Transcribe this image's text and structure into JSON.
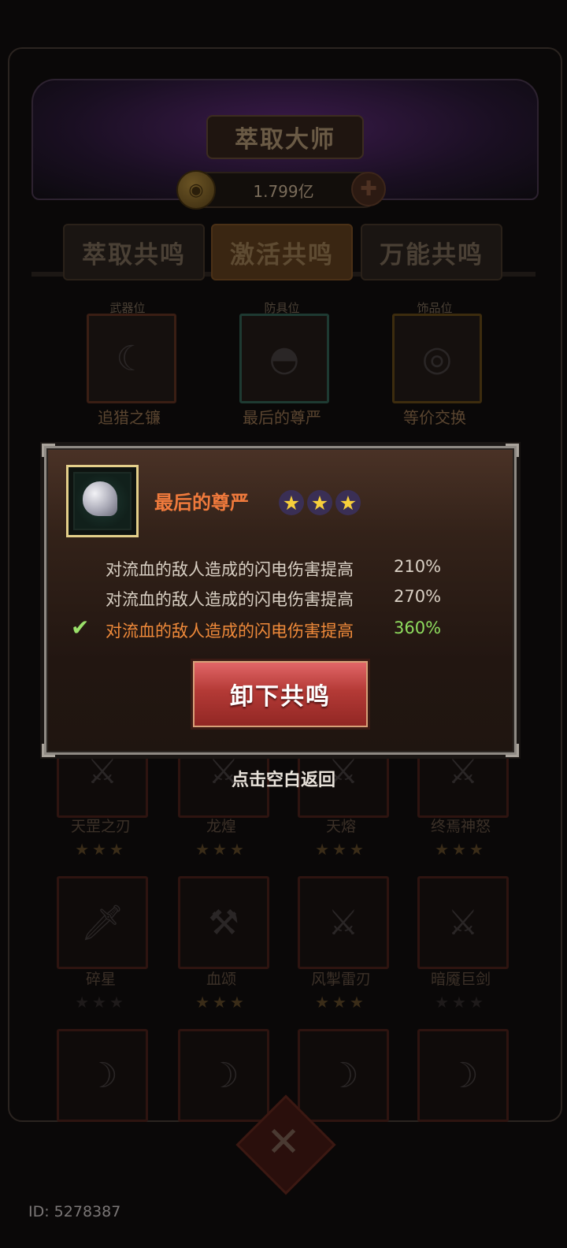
{
  "header": {
    "title": "萃取大师",
    "currency": "1.799亿"
  },
  "tabs": [
    {
      "label": "萃取共鸣"
    },
    {
      "label": "激活共鸣",
      "active": true
    },
    {
      "label": "万能共鸣"
    }
  ],
  "slots": [
    {
      "label": "武器位",
      "item": "追猎之镰"
    },
    {
      "label": "防具位",
      "item": "最后的尊严"
    },
    {
      "label": "饰品位",
      "item": "等价交换"
    }
  ],
  "grid": {
    "row1": [
      {
        "name": "天罡之刃",
        "stars": "★★★"
      },
      {
        "name": "龙煌",
        "stars": "★★★"
      },
      {
        "name": "天熔",
        "stars": "★★★"
      },
      {
        "name": "终焉神怒",
        "stars": "★★★"
      }
    ],
    "row2": [
      {
        "name": "碎星",
        "stars": "★★★"
      },
      {
        "name": "血颂",
        "stars": "★★★"
      },
      {
        "name": "风掣雷刃",
        "stars": "★★★"
      },
      {
        "name": "暗魇巨剑",
        "stars": "★★★"
      }
    ]
  },
  "popup": {
    "item_name": "最后的尊严",
    "stars": 3,
    "effects": [
      {
        "text": "对流血的敌人造成的闪电伤害提高",
        "value": "210%",
        "selected": false
      },
      {
        "text": "对流血的敌人造成的闪电伤害提高",
        "value": "270%",
        "selected": false
      },
      {
        "text": "对流血的敌人造成的闪电伤害提高",
        "value": "360%",
        "selected": true
      }
    ],
    "button_label": "卸下共鸣",
    "back_hint": "点击空白返回"
  },
  "footer": {
    "id_text": "ID: 5278387"
  },
  "colors": {
    "selected_effect": "#f08a3a",
    "selected_value": "#8edc5e",
    "button": "#b43a36"
  }
}
